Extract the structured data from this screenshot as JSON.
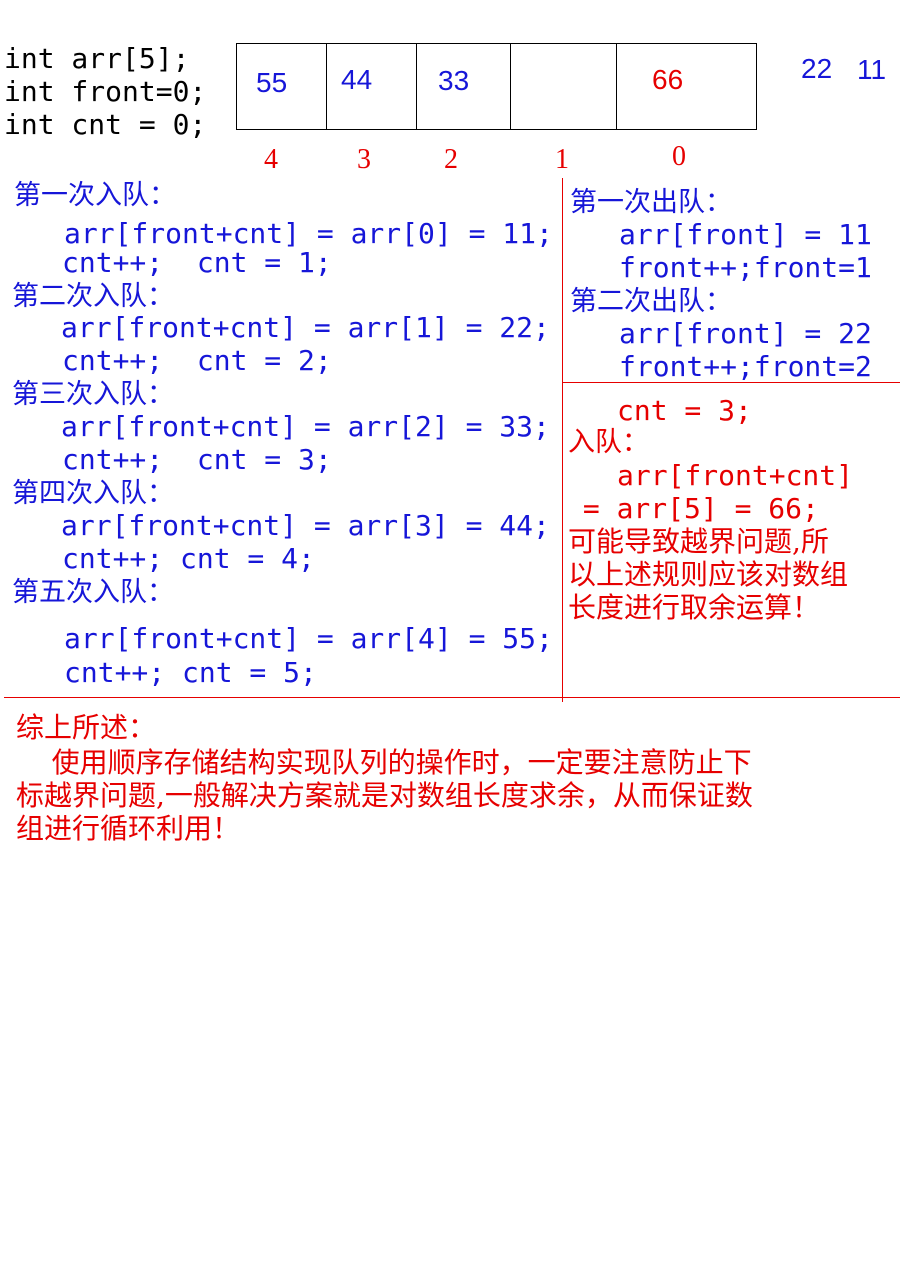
{
  "declarations": [
    "int arr[5];",
    "int front=0;",
    "int cnt = 0;"
  ],
  "array": {
    "cells": [
      "55",
      "44",
      "33",
      "",
      "66"
    ],
    "indices": [
      "4",
      "3",
      "2",
      "1",
      "0"
    ],
    "outside_values": [
      "22",
      "11"
    ]
  },
  "enqueue": [
    {
      "title": "第一次入队：",
      "code": "arr[front+cnt] = arr[0] = 11;",
      "count": "cnt++;  cnt = 1;"
    },
    {
      "title": "第二次入队：",
      "code": "arr[front+cnt] = arr[1] = 22;",
      "count": "cnt++;  cnt = 2;"
    },
    {
      "title": "第三次入队：",
      "code": "arr[front+cnt] = arr[2] = 33;",
      "count": "cnt++;  cnt = 3;"
    },
    {
      "title": "第四次入队：",
      "code": "arr[front+cnt] = arr[3] = 44;",
      "count": "cnt++; cnt = 4;"
    },
    {
      "title": "第五次入队：",
      "code": "arr[front+cnt] = arr[4] = 55;",
      "count": "cnt++; cnt = 5;"
    }
  ],
  "dequeue": [
    {
      "title": "第一次出队：",
      "code": "arr[front] = 11",
      "front": "front++;front=1"
    },
    {
      "title": "第二次出队：",
      "code": "arr[front] = 22",
      "front": "front++;front=2"
    }
  ],
  "overflow": {
    "cnt": "cnt = 3;",
    "title": "入队：",
    "code1": "arr[front+cnt]",
    "code2": " = arr[5] = 66;",
    "note": [
      "可能导致越界问题,所",
      "以上述规则应该对数组",
      "长度进行取余运算！"
    ]
  },
  "summary": {
    "title": "综上所述：",
    "lines": [
      "    使用顺序存储结构实现队列的操作时，一定要注意防止下",
      "标越界问题,一般解决方案就是对数组长度求余，从而保证数",
      "组进行循环利用！"
    ]
  }
}
